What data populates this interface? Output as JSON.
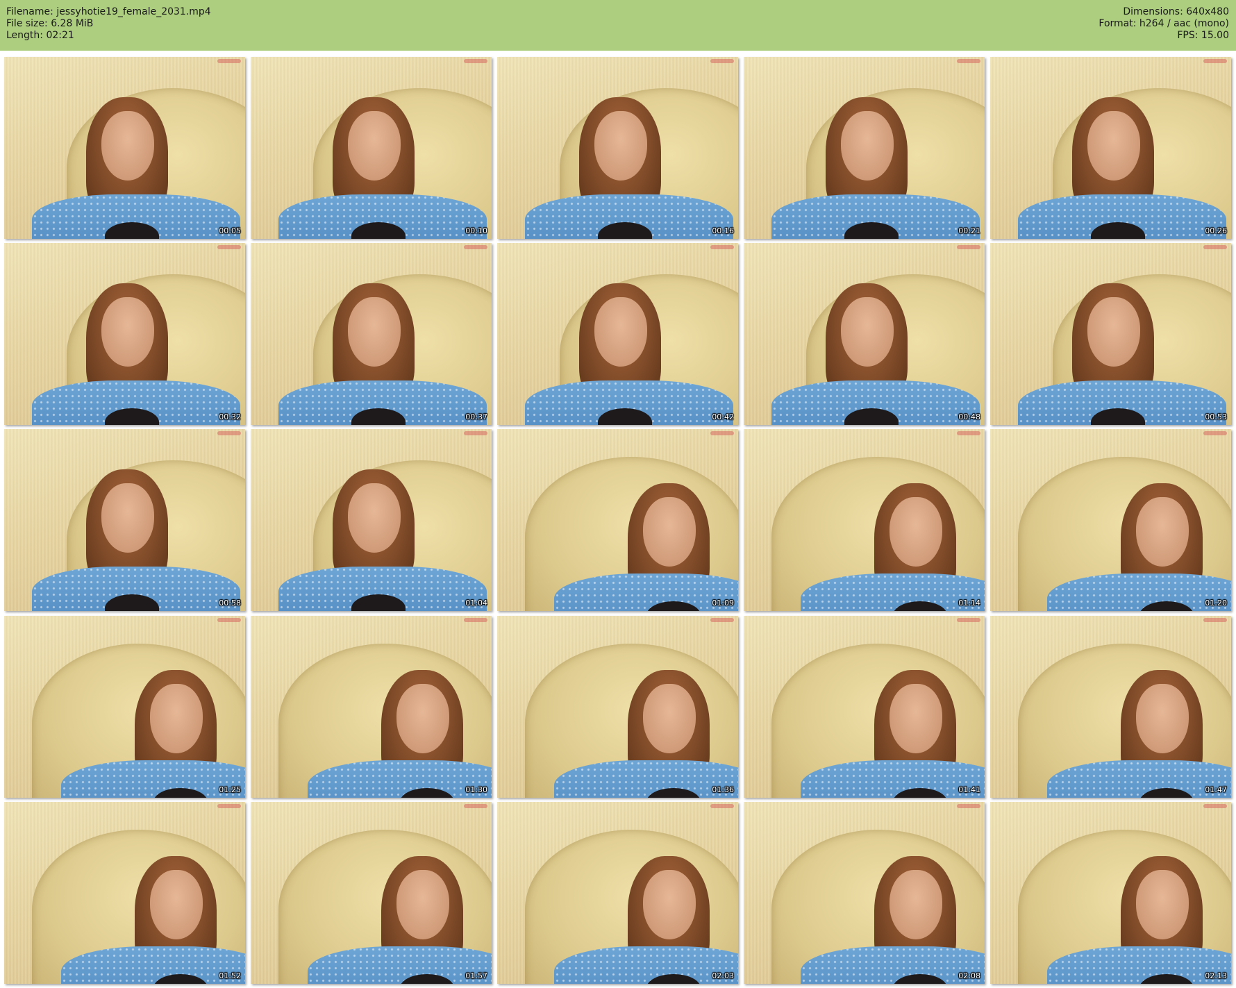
{
  "header": {
    "filename_label": "Filename:",
    "filename": "jessyhotie19_female_2031.mp4",
    "filesize_label": "File size:",
    "filesize": "6.28 MiB",
    "length_label": "Length:",
    "length": "02:21",
    "dimensions_label": "Dimensions:",
    "dimensions": "640x480",
    "format_label": "Format:",
    "format": "h264 / aac (mono)",
    "fps_label": "FPS:",
    "fps": "15.00"
  },
  "colors": {
    "header_bg": "#acce7e",
    "page_bg": "#ffffff"
  },
  "thumbnails": [
    {
      "timestamp": "00:05"
    },
    {
      "timestamp": "00:10"
    },
    {
      "timestamp": "00:16"
    },
    {
      "timestamp": "00:21"
    },
    {
      "timestamp": "00:26"
    },
    {
      "timestamp": "00:32"
    },
    {
      "timestamp": "00:37"
    },
    {
      "timestamp": "00:42"
    },
    {
      "timestamp": "00:48"
    },
    {
      "timestamp": "00:53"
    },
    {
      "timestamp": "00:58"
    },
    {
      "timestamp": "01:04"
    },
    {
      "timestamp": "01:09"
    },
    {
      "timestamp": "01:14"
    },
    {
      "timestamp": "01:20"
    },
    {
      "timestamp": "01:25"
    },
    {
      "timestamp": "01:30"
    },
    {
      "timestamp": "01:36"
    },
    {
      "timestamp": "01:41"
    },
    {
      "timestamp": "01:47"
    },
    {
      "timestamp": "01:52"
    },
    {
      "timestamp": "01:57"
    },
    {
      "timestamp": "02:03"
    },
    {
      "timestamp": "02:08"
    },
    {
      "timestamp": "02:13"
    }
  ]
}
